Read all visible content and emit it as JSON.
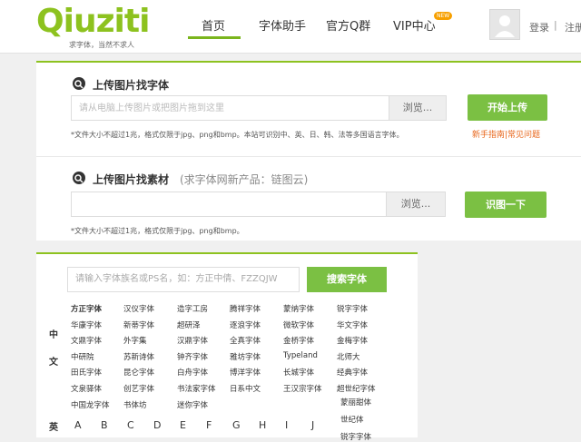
{
  "header": {
    "logo_text": "Qiuziti",
    "logo_slogan": "求字体，当然不求人",
    "nav": [
      "首页",
      "字体助手",
      "官方Q群",
      "VIP中心"
    ],
    "new_badge": "NEW",
    "login": "登录",
    "separator": "|",
    "register": "注册"
  },
  "upload_font": {
    "title": "上传图片找字体",
    "placeholder": "请从电脑上传图片或把图片拖到这里",
    "browse": "浏览...",
    "button": "开始上传",
    "note": "*文件大小不超过1兆，格式仅限于jpg、png和bmp。本站可识别中、英、日、韩、法等多国语言字体。",
    "help": "新手指南|常见问题"
  },
  "upload_material": {
    "title": "上传图片找素材",
    "subtitle": "(求字体网新产品：链图云)",
    "browse": "浏览...",
    "button": "识图一下",
    "note": "*文件大小不超过1兆，格式仅限于jpg、png和bmp。"
  },
  "font_search": {
    "placeholder": "请输入字体族名或PS名，如：方正中倩、FZZQJW",
    "button": "搜索字体"
  },
  "categories": {
    "chinese_label_1": "中",
    "chinese_label_2": "文",
    "english_label": "英"
  },
  "chinese_fonts": [
    [
      "方正字体",
      "汉仪字体",
      "造字工房",
      "腾祥字体",
      "蒙纳字体",
      "锐字字体"
    ],
    [
      "华康字体",
      "新蒂字体",
      "超研泽",
      "逐浪字体",
      "微软字体",
      "华文字体"
    ],
    [
      "文鼎字体",
      "外字集",
      "汉鼎字体",
      "全真字体",
      "金桥字体",
      "金梅字体"
    ],
    [
      "中研院",
      "苏新诗体",
      "钟齐字体",
      "雅坊字体",
      "Typeland",
      "北师大"
    ],
    [
      "田氏字体",
      "昆仑字体",
      "白舟字体",
      "博洋字体",
      "长城字体",
      "经典字体"
    ],
    [
      "文泉驿体",
      "创艺字体",
      "书法家字体",
      "日系中文",
      "王汉宗字体",
      "超世纪字体"
    ],
    [
      "中国龙字体",
      "书体坊",
      "迷你字体"
    ]
  ],
  "letters": [
    "A",
    "B",
    "C",
    "D",
    "E",
    "F",
    "G",
    "H",
    "I",
    "J"
  ],
  "dropdown_items": [
    "蒙丽甜体",
    "世纪体",
    "锐字字体"
  ],
  "colors": {
    "brand_green": "#8dc21f",
    "button_green": "#7bc043",
    "help_orange": "#e8661b"
  }
}
